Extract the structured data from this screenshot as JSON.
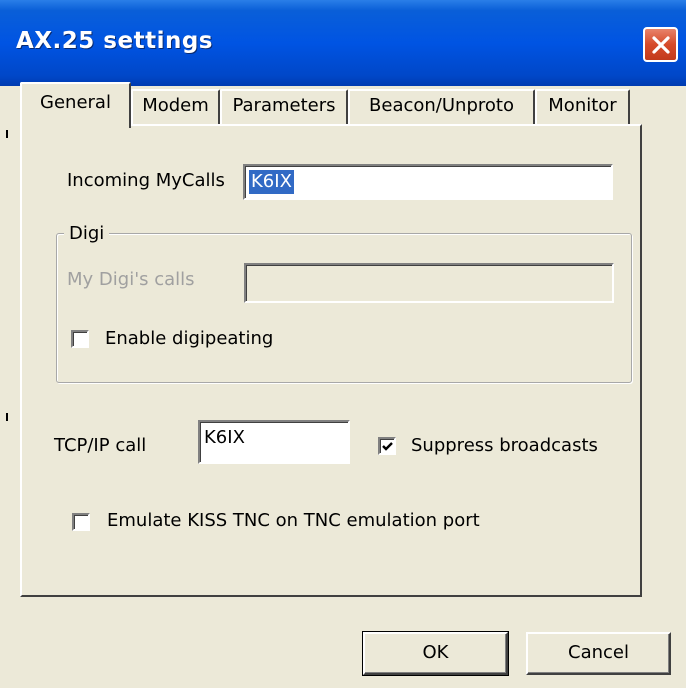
{
  "window": {
    "title": "AX.25 settings"
  },
  "tabs": [
    {
      "label": "General",
      "selected": true
    },
    {
      "label": "Modem",
      "selected": false
    },
    {
      "label": "Parameters",
      "selected": false
    },
    {
      "label": "Beacon/Unproto",
      "selected": false
    },
    {
      "label": "Monitor",
      "selected": false
    }
  ],
  "general": {
    "incoming_mycalls_label": "Incoming MyCalls",
    "incoming_mycalls_value": "K6IX",
    "digi_group_label": "Digi",
    "my_digi_calls_label": "My Digi's calls",
    "my_digi_calls_value": "",
    "enable_digipeating_label": "Enable digipeating",
    "enable_digipeating_checked": false,
    "tcpip_call_label": "TCP/IP call",
    "tcpip_call_value": "K6IX",
    "suppress_broadcasts_label": "Suppress broadcasts",
    "suppress_broadcasts_checked": true,
    "emulate_kiss_label": "Emulate KISS TNC on TNC emulation port",
    "emulate_kiss_checked": false
  },
  "buttons": {
    "ok_label": "OK",
    "cancel_label": "Cancel"
  },
  "colors": {
    "titlebar": "#0054e3",
    "dialog": "#ece9d8",
    "selection": "#316ac5",
    "close": "#d64a2a"
  },
  "icons": {
    "close": "close-icon",
    "checkmark": "checkmark-icon"
  }
}
